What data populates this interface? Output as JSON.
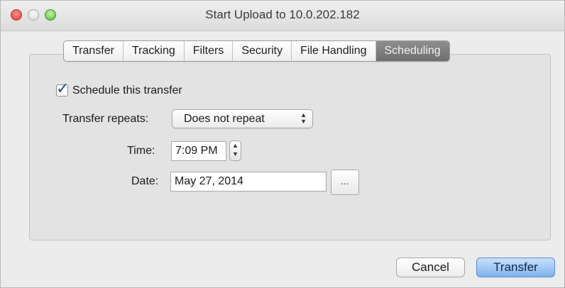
{
  "window": {
    "title": "Start Upload to 10.0.202.182"
  },
  "tabs": [
    {
      "label": "Transfer",
      "active": false
    },
    {
      "label": "Tracking",
      "active": false
    },
    {
      "label": "Filters",
      "active": false
    },
    {
      "label": "Security",
      "active": false
    },
    {
      "label": "File Handling",
      "active": false
    },
    {
      "label": "Scheduling",
      "active": true
    }
  ],
  "schedule": {
    "checkbox_label": "Schedule this transfer",
    "checked": true,
    "repeats_label": "Transfer repeats:",
    "repeats_value": "Does not repeat",
    "time_label": "Time:",
    "time_value": "7:09 PM",
    "date_label": "Date:",
    "date_value": "May 27, 2014",
    "browse_label": "..."
  },
  "buttons": {
    "cancel": "Cancel",
    "transfer": "Transfer"
  },
  "colors": {
    "active_tab": "#7f7f7f",
    "default_button": "#8fbcef",
    "close_button": "#e0443e",
    "zoom_button": "#5fbd44"
  }
}
